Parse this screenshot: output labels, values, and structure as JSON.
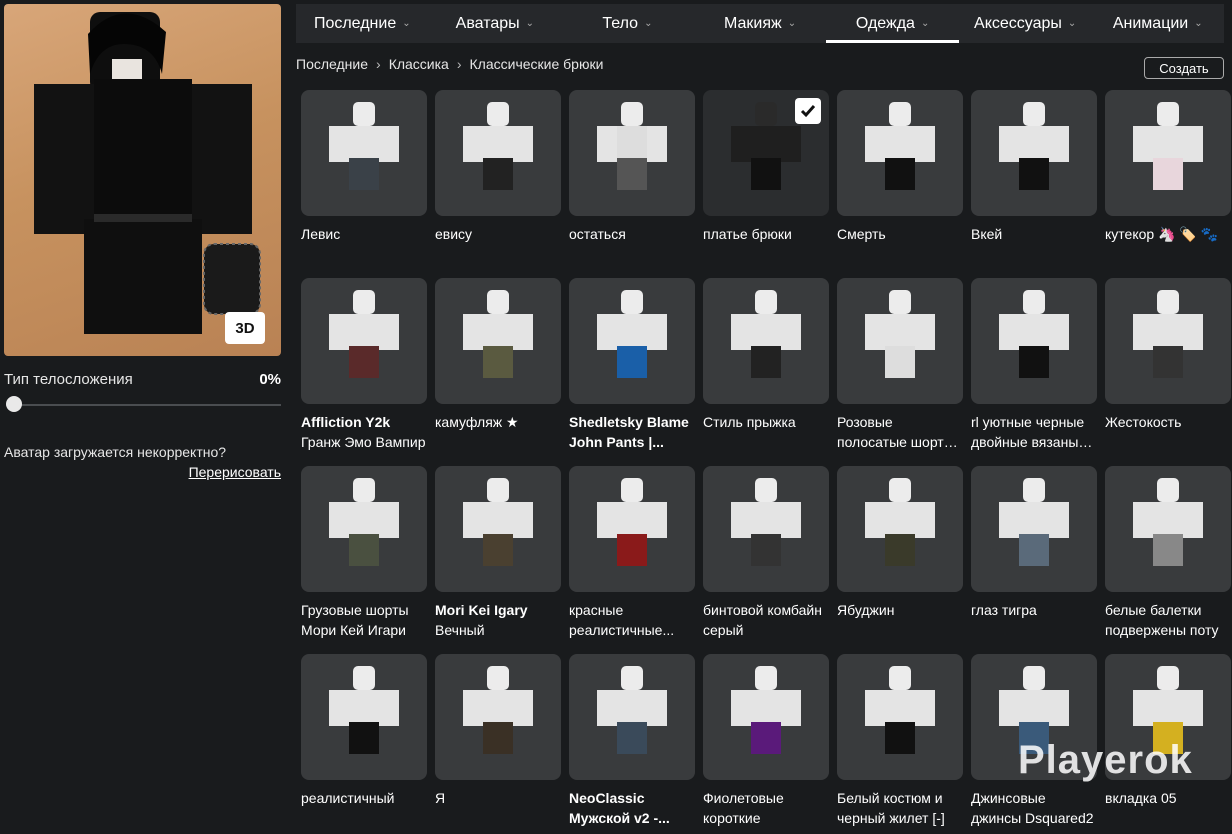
{
  "tabs": [
    {
      "label": "Последние"
    },
    {
      "label": "Аватары"
    },
    {
      "label": "Тело"
    },
    {
      "label": "Макияж"
    },
    {
      "label": "Одежда",
      "active": true
    },
    {
      "label": "Аксессуары"
    },
    {
      "label": "Анимации"
    }
  ],
  "breadcrumb": [
    "Последние",
    "Классика",
    "Классические брюки"
  ],
  "create_label": "Создать",
  "left_panel": {
    "badge_3d": "3D",
    "scale_label": "Тип телосложения",
    "scale_value": "0%",
    "scale_fraction": 0,
    "issue_text": "Аватар загружается некорректно?",
    "redraw_label": "Перерисовать"
  },
  "items": [
    {
      "line1": "Левис",
      "line2": "",
      "pants": "#3a4148"
    },
    {
      "line1": "евису",
      "line2": "",
      "pants": "#222"
    },
    {
      "line1": "остаться",
      "line2": "",
      "pants": "#555",
      "top": "#ddd"
    },
    {
      "line1": "платье брюки",
      "line2": "",
      "pants": "#111",
      "selected": true
    },
    {
      "line1": "Смерть",
      "line2": "",
      "pants": "#111"
    },
    {
      "line1": "Вкей",
      "line2": "",
      "pants": "#111"
    },
    {
      "line1": "кутекор 🦄 🏷️ 🐾",
      "line2": "",
      "pants": "#e8d6dc"
    },
    {
      "line1": "Affliction Y2k",
      "line2": "Гранж Эмо Вампир",
      "pants": "#5a2a2a",
      "bold": true
    },
    {
      "line1": "камуфляж ★",
      "line2": "",
      "pants": "#5a5a40"
    },
    {
      "line1": "Shedletsky Blame",
      "line2": "John Pants |...",
      "pants": "#1a5fa8",
      "bold": true,
      "bold2": true
    },
    {
      "line1": "Стиль прыжка",
      "line2": "",
      "pants": "#222"
    },
    {
      "line1": "Розовые",
      "line2": "полосатые шорты...",
      "pants": "#ddd"
    },
    {
      "line1": "rl уютные черные",
      "line2": "двойные вязаные...",
      "pants": "#111",
      "bold_prefix": "rl"
    },
    {
      "line1": "Жестокость",
      "line2": "",
      "pants": "#333"
    },
    {
      "line1": "Грузовые шорты",
      "line2": "Мори Кей Игари",
      "pants": "#4a5040"
    },
    {
      "line1": "Mori Kei Igary",
      "line2": "Вечный",
      "pants": "#4a4030",
      "bold": true
    },
    {
      "line1": "красные",
      "line2": "реалистичные...",
      "pants": "#8a1a1a"
    },
    {
      "line1": "бинтовой комбайн",
      "line2": "серый",
      "pants": "#333"
    },
    {
      "line1": "Ябуджин",
      "line2": "",
      "pants": "#3a3a2a"
    },
    {
      "line1": "глаз тигра",
      "line2": "",
      "pants": "#5a6a7a"
    },
    {
      "line1": "белые балетки",
      "line2": "подвержены поту",
      "pants": "#888"
    },
    {
      "line1": "реалистичный",
      "line2": "",
      "pants": "#111"
    },
    {
      "line1": "Я",
      "line2": "",
      "pants": "#3a3025"
    },
    {
      "line1": "NeoClassic",
      "line2": "Мужской v2 -...",
      "pants": "#3a4a5a",
      "bold": true,
      "bold2": true
    },
    {
      "line1": "Фиолетовые",
      "line2": "короткие",
      "pants": "#5a1a7a"
    },
    {
      "line1": "Белый костюм и",
      "line2": "черный жилет [-]",
      "pants": "#111"
    },
    {
      "line1": "Джинсовые",
      "line2": "джинсы Dsquared2",
      "pants": "#3a5a7a"
    },
    {
      "line1": "вкладка 05",
      "line2": "",
      "pants": "#d4b020"
    }
  ],
  "watermark": "Playerok"
}
